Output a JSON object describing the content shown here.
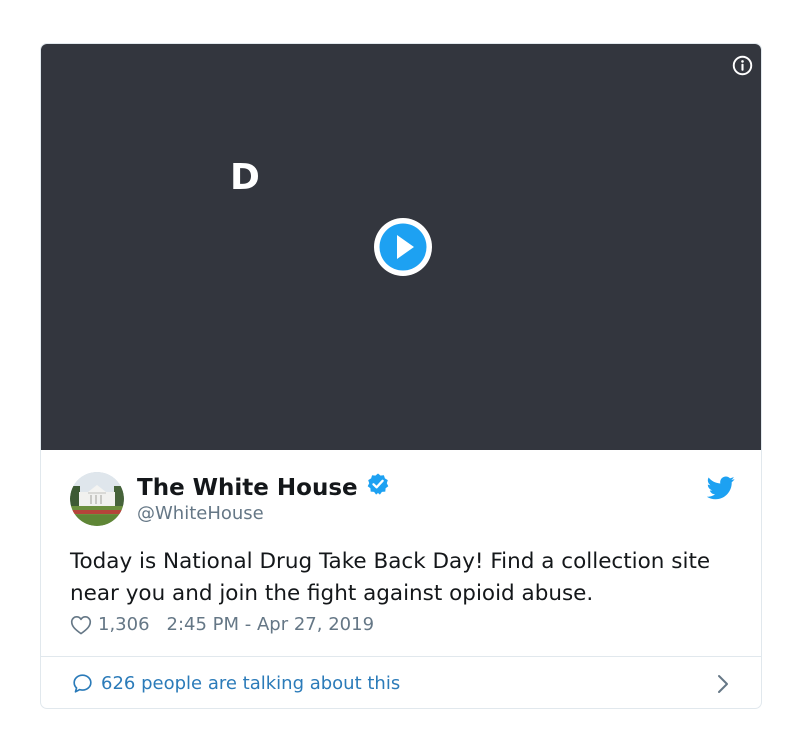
{
  "media": {
    "overlay_letter": "D",
    "info_icon": "info-icon",
    "play_icon": "play-icon",
    "colors": {
      "background": "#33363e",
      "play": "#1da1f2"
    }
  },
  "tweet": {
    "author_name": "The White House",
    "handle": "@WhiteHouse",
    "verified_icon": "verified-badge-icon",
    "brand_icon": "twitter-bird-icon",
    "text": "Today is National Drug Take Back Day! Find a collection site near you and join the fight against opioid abuse.",
    "likes": "1,306",
    "timestamp": "2:45 PM - Apr 27, 2019",
    "heart_icon": "heart-icon"
  },
  "footer": {
    "talking_label": "626 people are talking about this",
    "bubble_icon": "speech-bubble-icon",
    "chevron_icon": "chevron-right-icon"
  },
  "colors": {
    "accent": "#1da1f2",
    "link": "#2b7bb9",
    "secondary_text": "#657786",
    "border": "#e1e8ed"
  }
}
